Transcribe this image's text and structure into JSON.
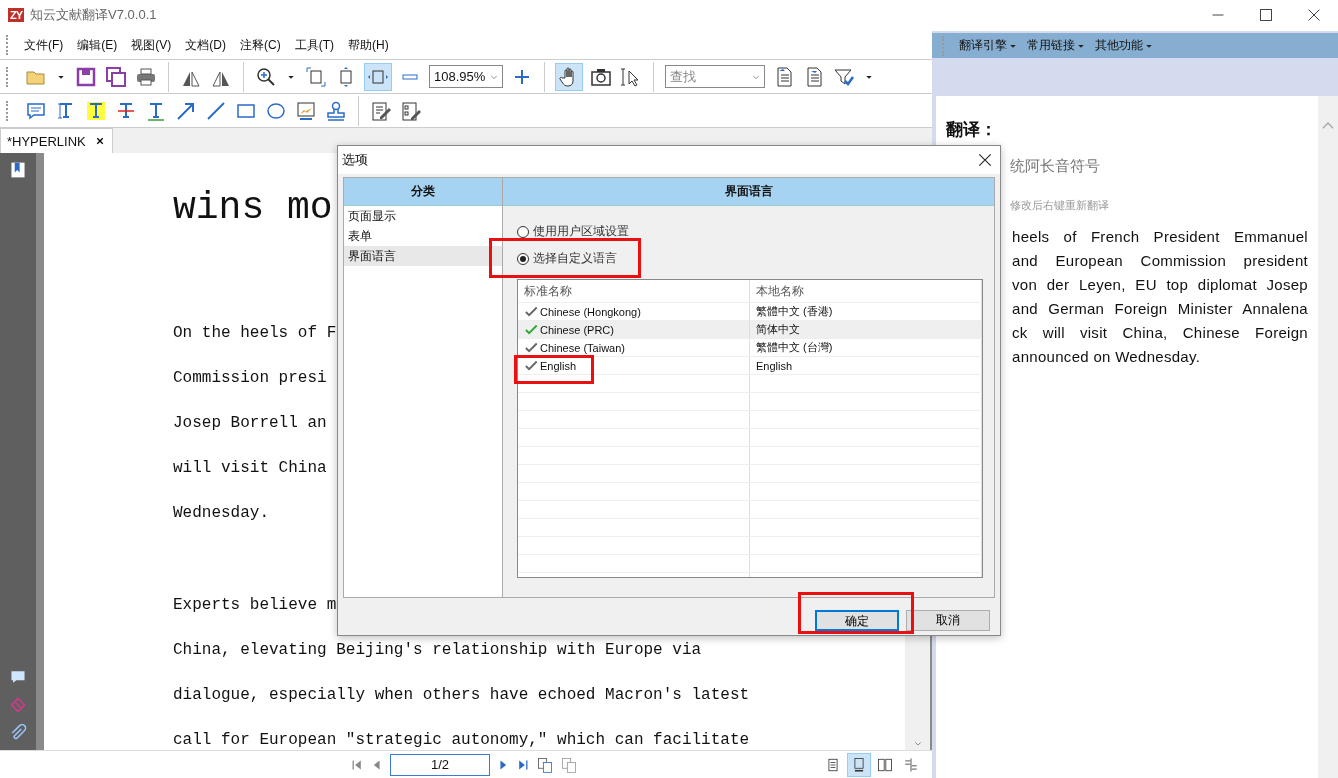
{
  "window": {
    "logo": "ZY",
    "title": "知云文献翻译V7.0.0.1"
  },
  "menu": [
    "文件(F)",
    "编辑(E)",
    "视图(V)",
    "文档(D)",
    "注释(C)",
    "工具(T)",
    "帮助(H)"
  ],
  "toolbar": {
    "fit_width_selected": true,
    "zoom_value": "108.95%",
    "hand_tool_selected": true,
    "search_placeholder": "查找"
  },
  "tab": {
    "label": "*HYPERLINK",
    "selected": true
  },
  "document": {
    "heading": "wins mo",
    "paragraphs": [
      [
        "On the heels of F",
        "Commission presi",
        "Josep Borrell an",
        "will visit China",
        "Wednesday."
      ],
      [
        "Experts believe m",
        "China, elevating Beijing's relationship with Europe via",
        "dialogue, especially when others have echoed Macron's latest",
        "call for European \"strategic autonomy,\" which can facilitate"
      ]
    ]
  },
  "page_nav": {
    "value": "1/2"
  },
  "view_modes": [
    {
      "kind": "single",
      "selected": false
    },
    {
      "kind": "continuous",
      "selected": true
    },
    {
      "kind": "facing",
      "selected": false
    },
    {
      "kind": "split",
      "selected": false
    }
  ],
  "side_panel": {
    "menus": [
      "翻译引擎",
      "常用链接",
      "其他功能"
    ],
    "heading": "翻译：",
    "term": "统阿长音符号",
    "hint": "修改后右键重新翻译",
    "lines": [
      "heels of French President Emmanuel",
      "and European Commission president",
      "von der Leyen, EU top diplomat Josep",
      "and German Foreign Minister Annalena",
      "ck will visit China, Chinese Foreign",
      "announced on Wednesday."
    ]
  },
  "dialog": {
    "title": "选项",
    "category_header": "分类",
    "categories": [
      {
        "label": "页面显示",
        "selected": false
      },
      {
        "label": "表单",
        "selected": false
      },
      {
        "label": "界面语言",
        "selected": true
      }
    ],
    "section_header": "界面语言",
    "options": [
      {
        "label": "使用用户区域设置",
        "selected": false
      },
      {
        "label": "选择自定义语言",
        "selected": true
      }
    ],
    "table": {
      "columns": [
        "标准名称",
        "本地名称"
      ],
      "rows": [
        {
          "name": "Chinese (Hongkong)",
          "local": "繁體中文 (香港)",
          "selected": false
        },
        {
          "name": "Chinese (PRC)",
          "local": "简体中文",
          "selected": true
        },
        {
          "name": "Chinese (Taiwan)",
          "local": "繁體中文 (台灣)",
          "selected": false
        },
        {
          "name": "English",
          "local": "English",
          "selected": false
        }
      ]
    },
    "buttons": [
      {
        "label": "确定",
        "kind": "primary"
      },
      {
        "label": "取消",
        "kind": "secondary"
      }
    ]
  }
}
